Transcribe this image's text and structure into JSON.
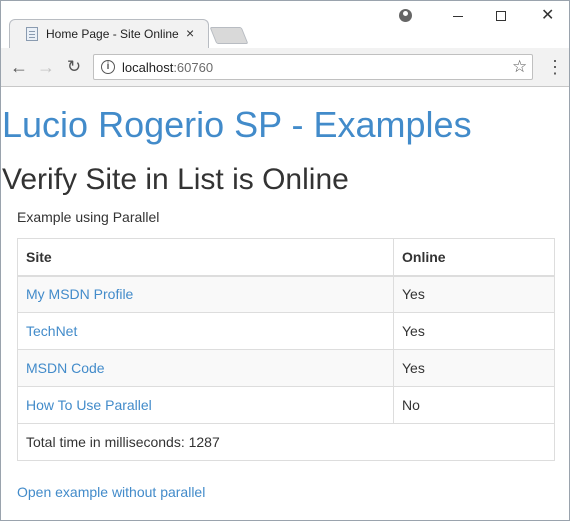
{
  "browser": {
    "tab_title": "Home Page - Site Online",
    "tab_close": "×",
    "url_host": "localhost",
    "url_port": ":60760"
  },
  "icons": {
    "back": "←",
    "forward": "→",
    "reload": "↻",
    "star": "☆",
    "menu": "⋮",
    "close_window": "✕",
    "info": "i"
  },
  "page": {
    "site_title": "Lucio Rogerio SP - Examples",
    "heading": "Verify Site in List is Online",
    "subtitle": "Example using Parallel",
    "footer_link": "Open example without parallel"
  },
  "table": {
    "headers": {
      "site": "Site",
      "online": "Online"
    },
    "rows": [
      {
        "site": "My MSDN Profile",
        "online": "Yes"
      },
      {
        "site": "TechNet",
        "online": "Yes"
      },
      {
        "site": "MSDN Code",
        "online": "Yes"
      },
      {
        "site": "How To Use Parallel",
        "online": "No"
      }
    ],
    "total": "Total time in milliseconds: 1287"
  },
  "colors": {
    "link": "#428bca",
    "text": "#333333",
    "stripe": "#f9f9f9"
  }
}
